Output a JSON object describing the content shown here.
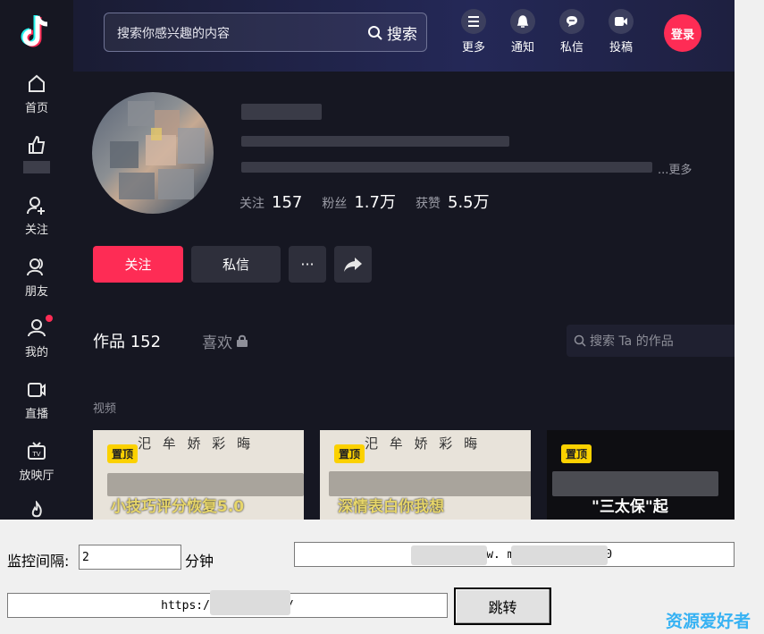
{
  "sidebar": {
    "items": [
      {
        "label": "首页",
        "icon": "home-icon"
      },
      {
        "label": "",
        "icon": "thumb-up-icon"
      },
      {
        "label": "关注",
        "icon": "add-user-icon"
      },
      {
        "label": "朋友",
        "icon": "friends-icon"
      },
      {
        "label": "我的",
        "icon": "person-icon"
      },
      {
        "label": "直播",
        "icon": "live-icon"
      },
      {
        "label": "放映厅",
        "icon": "tv-icon"
      }
    ]
  },
  "header": {
    "search_placeholder": "搜索你感兴趣的内容",
    "search_button": "搜索",
    "icons": [
      {
        "label": "更多",
        "icon": "menu-icon"
      },
      {
        "label": "通知",
        "icon": "bell-icon"
      },
      {
        "label": "私信",
        "icon": "chat-icon"
      },
      {
        "label": "投稿",
        "icon": "upload-icon"
      }
    ],
    "login": "登录"
  },
  "profile": {
    "more": "...更多",
    "stats": [
      {
        "label": "关注",
        "value": "157"
      },
      {
        "label": "粉丝",
        "value": "1.7万"
      },
      {
        "label": "获赞",
        "value": "5.5万"
      }
    ],
    "buttons": {
      "follow": "关注",
      "message": "私信",
      "more": "···"
    }
  },
  "tabs": {
    "works": "作品 152",
    "likes": "喜欢",
    "search_placeholder": "搜索 Ta 的作品",
    "section": "视频"
  },
  "videos": [
    {
      "badge": "置顶",
      "caption": "小技巧评分恢复5.0"
    },
    {
      "badge": "置顶",
      "caption": "深情表白你我想"
    },
    {
      "badge": "置顶",
      "caption": "\"三太保\"起"
    }
  ],
  "controls": {
    "interval_label": "监控间隔:",
    "interval_value": "2",
    "interval_unit": "分钟",
    "url_right": "https://www.                m/                668640644390",
    "url_left": "https://v.d                ANqdYY/",
    "jump_button": "跳转"
  },
  "watermark": "资源爱好者",
  "colors": {
    "accent": "#fe2c55",
    "background": "#161722",
    "badge": "#fbd100",
    "watermark": "#37b2f3"
  }
}
